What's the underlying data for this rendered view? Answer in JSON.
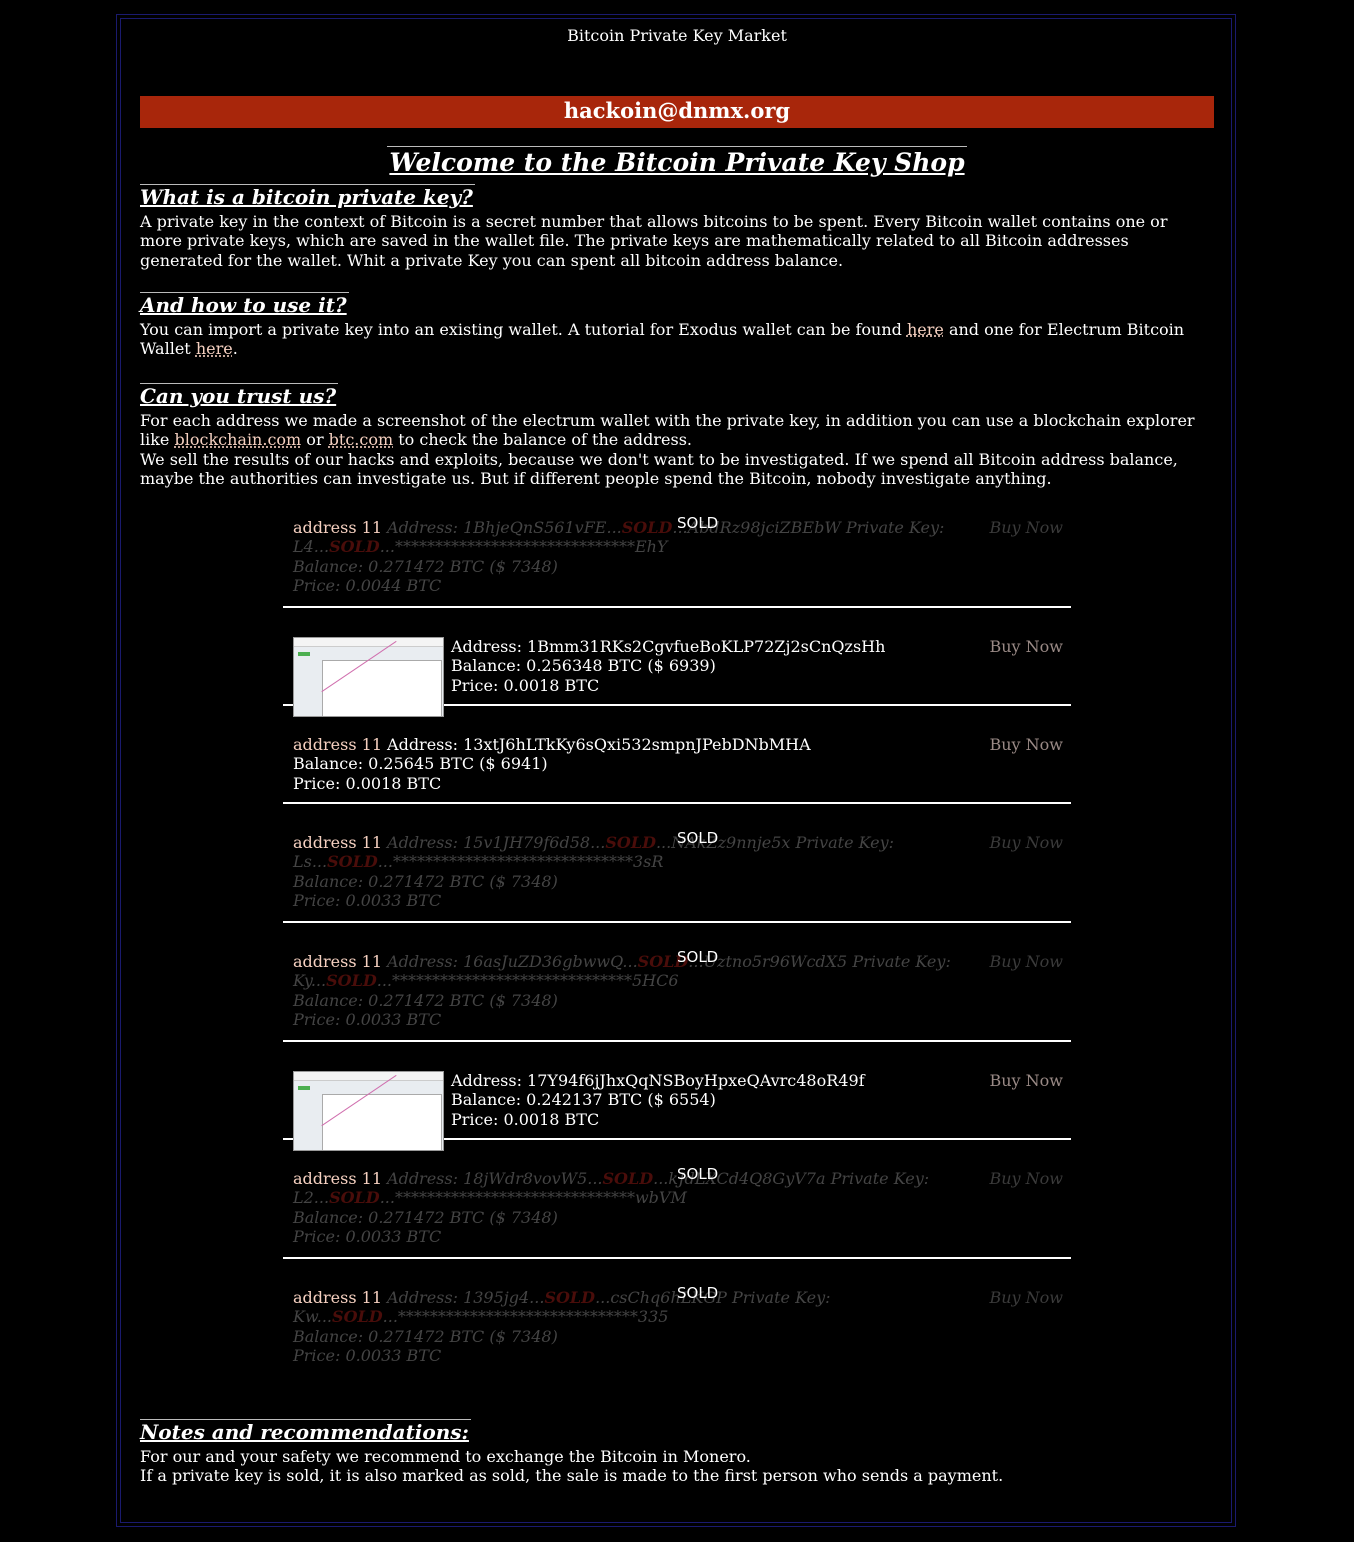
{
  "site_title": "Bitcoin Private Key Market",
  "email": "hackoin@dnmx.org",
  "welcome": "Welcome to the Bitcoin Private Key Shop",
  "sections": {
    "what": {
      "heading": "What is a bitcoin private key?",
      "text": "A private key in the context of Bitcoin is a secret number that allows bitcoins to be spent. Every Bitcoin wallet contains one or more private keys, which are saved in the wallet file. The private keys are mathematically related to all Bitcoin addresses generated for the wallet. Whit a private Key you can spent all bitcoin address balance."
    },
    "how": {
      "heading": "And how to use it?",
      "text_1": "You can import a private key into an existing wallet. A tutorial for Exodus wallet can be found ",
      "link_1": "here",
      "text_2": " and one for Electrum Bitcoin Wallet ",
      "link_2": "here",
      "text_3": "."
    },
    "trust": {
      "heading": "Can you trust us?",
      "text_1": "For each address we made a screenshot of the electrum wallet with the private key, in addition you can use a blockchain explorer like ",
      "link_1": "blockchain.com",
      "text_2": " or ",
      "link_2": "btc.com",
      "text_3": " to check the balance of the address.",
      "text_4": "We sell the results of our hacks and exploits, because we don't want to be investigated. If we spend all Bitcoin address balance, maybe the authorities can investigate us. But if different people spend the Bitcoin, nobody investigate anything."
    },
    "notes": {
      "heading": "Notes and recommendations:",
      "line_1": "For our and your safety we recommend to exchange the Bitcoin in Monero.",
      "line_2": "If a private key is sold, it is also marked as sold, the sale is made to the first person who sends a payment."
    }
  },
  "buy_label": "Buy Now",
  "sold_label": "SOLD",
  "address_label": "address 11",
  "sold_items": [
    {
      "a_start": "Address: 1BhjeQnS561vFE...",
      "a_end": "...AbdRz98jciZBEbW Private Key:",
      "k_start": "L4...",
      "k_end": "...******************************EhY",
      "balance": "Balance: 0.271472 BTC ($ 7348)",
      "price": "Price: 0.0044 BTC"
    },
    {
      "a_start": "Address: 15v1JH79f6d58...",
      "a_end": "...NAkZz9nnje5x Private Key:",
      "k_start": "Ls...",
      "k_end": "...******************************3sR",
      "balance": "Balance: 0.271472 BTC ($ 7348)",
      "price": "Price: 0.0033 BTC"
    },
    {
      "a_start": "Address: 16asJuZD36gbwwQ...",
      "a_end": "...Uztno5r96WcdX5 Private Key:",
      "k_start": "Ky...",
      "k_end": "...******************************5HC6",
      "balance": "Balance: 0.271472 BTC ($ 7348)",
      "price": "Price: 0.0033 BTC"
    },
    {
      "a_start": "Address: 18jWdr8vovW5...",
      "a_end": "...kJdLXCd4Q8GyV7a Private Key:",
      "k_start": "L2...",
      "k_end": "...******************************wbVM",
      "balance": "Balance: 0.271472 BTC ($ 7348)",
      "price": "Price: 0.0033 BTC"
    },
    {
      "a_start": "Address: 1395jg4...",
      "a_end": "...csChq6hLKGP Private Key:",
      "k_start": "Kw...",
      "k_end": "...******************************335",
      "balance": "Balance: 0.271472 BTC ($ 7348)",
      "price": "Price: 0.0033 BTC"
    }
  ],
  "live_items": [
    {
      "address": "Address: 1Bmm31RKs2CgvfueBoKLP72Zj2sCnQzsHh",
      "balance": "Balance: 0.256348 BTC ($ 6939)",
      "price": "Price: 0.0018 BTC"
    },
    {
      "address": "Address: 13xtJ6hLTkKy6sQxi532smpnJPebDNbMHA",
      "balance": "Balance: 0.25645 BTC ($ 6941)",
      "price": "Price: 0.0018 BTC"
    },
    {
      "address": "Address: 17Y94f6jJhxQqNSBoyHpxeQAvrc48oR49f",
      "balance": "Balance: 0.242137 BTC ($ 6554)",
      "price": "Price: 0.0018 BTC"
    }
  ]
}
